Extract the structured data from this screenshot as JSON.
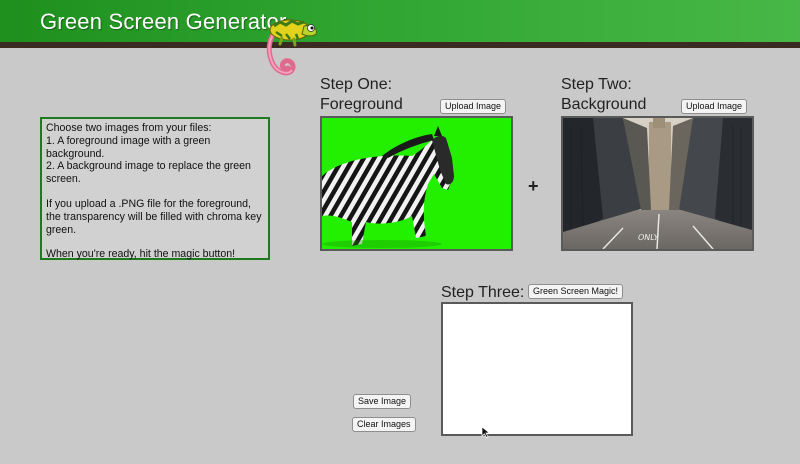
{
  "header": {
    "title": "Green Screen Generator",
    "logo_icon": "chameleon-icon"
  },
  "instructions": {
    "line1": "Choose two images from your files:",
    "line2": "1. A foreground image with a green background.",
    "line3": "2. A background image to replace the green screen.",
    "line4": "If you upload a .PNG file for the foreground, the transparency will be filled with chroma key green.",
    "line5": "When you're ready, hit the magic button!"
  },
  "step_one": {
    "label_line1": "Step One:",
    "label_line2": "Foreground",
    "upload_label": "Upload Image"
  },
  "step_two": {
    "label_line1": "Step Two:",
    "label_line2": "Background",
    "upload_label": "Upload Image"
  },
  "plus_sign": "+",
  "step_three": {
    "label": "Step Three:",
    "magic_label": "Green Screen Magic!"
  },
  "actions": {
    "save_label": "Save Image",
    "clear_label": "Clear Images"
  },
  "colors": {
    "chroma_green": "#23f000",
    "header_green": "#2ea32e",
    "header_bar": "#3a2a22"
  }
}
